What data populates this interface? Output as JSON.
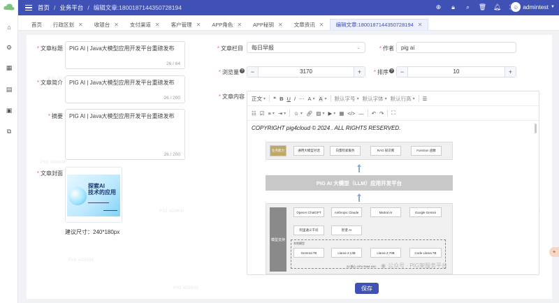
{
  "header": {
    "breadcrumb": [
      "首页",
      "业务平台",
      "编辑文章:1800187144350728194"
    ],
    "username": "admintest"
  },
  "tabs": [
    {
      "label": "首页",
      "closable": false,
      "active": false
    },
    {
      "label": "行政区划",
      "closable": true,
      "active": false
    },
    {
      "label": "收银台",
      "closable": true,
      "active": false
    },
    {
      "label": "支付渠道",
      "closable": true,
      "active": false
    },
    {
      "label": "客户管理",
      "closable": true,
      "active": false
    },
    {
      "label": "APP角色",
      "closable": true,
      "active": false
    },
    {
      "label": "APP秘钥",
      "closable": true,
      "active": false
    },
    {
      "label": "文章资讯",
      "closable": true,
      "active": false
    },
    {
      "label": "编辑文章:1800187144350728194",
      "closable": true,
      "active": true
    }
  ],
  "form": {
    "title": {
      "label": "文章标题",
      "value": "PIG AI | Java大模型应用开发平台重磅发布",
      "count": "26 / 64"
    },
    "intro": {
      "label": "文章简介",
      "value": "PIG AI | Java大模型应用开发平台重磅发布",
      "count": "26 / 200"
    },
    "summary": {
      "label": "摘要",
      "value": "PIG AI | Java大模型应用开发平台重磅发布",
      "count": "26 / 200"
    },
    "cover": {
      "label": "文章封面",
      "image_title_line1": "探索AI",
      "image_title_line2": "技术的应用",
      "hint": "建议尺寸：240*180px"
    },
    "column": {
      "label": "文章栏目",
      "value": "每日早报"
    },
    "author": {
      "label": "作者",
      "value": "pig ai"
    },
    "views": {
      "label": "浏览量",
      "value": "3170"
    },
    "sort": {
      "label": "排序",
      "value": "10"
    },
    "content": {
      "label": "文章内容"
    }
  },
  "editor": {
    "toolbar_row1": [
      "正文",
      "❝",
      "B",
      "U",
      "I",
      "A",
      "A",
      "默认字号",
      "默认字体",
      "默认行高"
    ],
    "copyright": "COPYRIGHT pig4cloud © 2024 . ALL RIGHTS RESERVED.",
    "diagram": {
      "top_left": "业务能力",
      "top_items": [
        "通用大模型对话",
        "向量检索服务",
        "RAG 知识库",
        "Function 函数"
      ],
      "main": "PIG AI 大模型（LLM）应用开发平台",
      "side": "模型支持",
      "row1": [
        "OpenAI ChatGPT",
        "Anthropic Claude",
        "Mistral AI",
        "Google Gemini"
      ],
      "row2": [
        "阿里通义千问",
        "智谱 AI"
      ],
      "local_label": "本地模型",
      "row3": [
        "Gemma:7B",
        "Llama 2:13B",
        "Llama 2:70B",
        "Code Llama:7B"
      ],
      "row3_note": "24 核心 GPU RAM 16G"
    }
  },
  "actions": {
    "save": "保存"
  },
  "watermark": "PIG ADMIN",
  "wechat_watermark": "公众号 · PIG架服务平台",
  "colors": {
    "primary": "#3f51b5",
    "required": "#f56c6c"
  }
}
